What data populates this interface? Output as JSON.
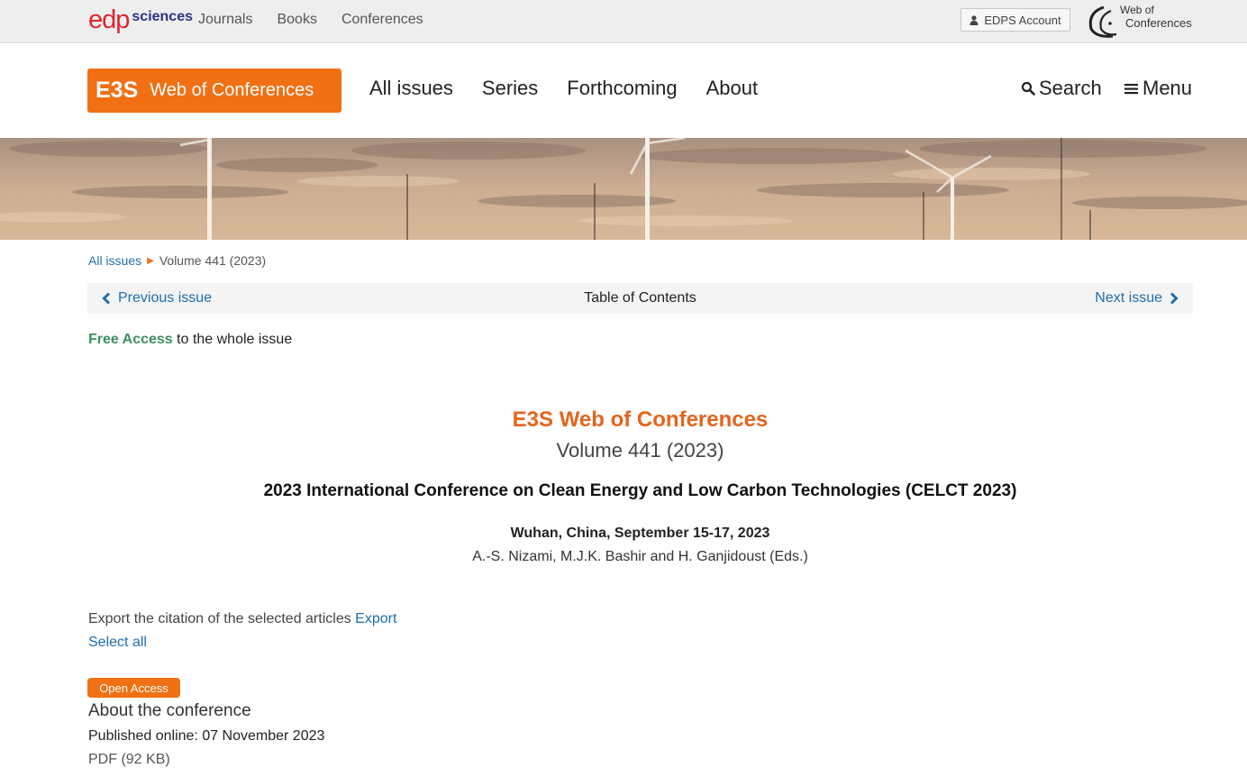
{
  "topbar": {
    "brand_edp": "edp",
    "brand_sciences": "sciences",
    "nav": [
      "Journals",
      "Books",
      "Conferences"
    ],
    "account_label": "EDPS Account",
    "wofc_line1": "Web of",
    "wofc_line2": "Conferences"
  },
  "header": {
    "logo_short": "E3S",
    "logo_long": "Web of Conferences",
    "nav": [
      "All issues",
      "Series",
      "Forthcoming",
      "About"
    ],
    "search_label": "Search",
    "menu_label": "Menu"
  },
  "breadcrumb": {
    "root": "All issues",
    "current": "Volume 441 (2023)"
  },
  "toc": {
    "prev_label": "Previous issue",
    "title": "Table of Contents",
    "next_label": "Next issue"
  },
  "access": {
    "free_label": "Free Access",
    "rest": " to the whole issue"
  },
  "issue": {
    "journal_title": "E3S Web of Conferences",
    "volume": "Volume 441 (2023)",
    "conference": "2023 International Conference on Clean Energy and Low Carbon Technologies (CELCT 2023)",
    "location": "Wuhan, China, September 15-17, 2023",
    "editors": "A.-S. Nizami, M.J.K. Bashir and H. Ganjidoust (Eds.)"
  },
  "export": {
    "text": "Export the citation of the selected articles ",
    "link": "Export",
    "select_all": "Select all"
  },
  "article": {
    "badge": "Open Access",
    "title": "About the conference",
    "published": "Published online: 07 November 2023",
    "pdf": "PDF (92 KB)"
  },
  "colors": {
    "brand_orange": "#f07013",
    "link_blue": "#1e6eb0",
    "free_green": "#3c8f5e"
  },
  "icons": [
    "user-icon",
    "search-icon",
    "menu-icon",
    "chevron-left-icon",
    "chevron-right-icon",
    "breadcrumb-arrow-icon"
  ]
}
